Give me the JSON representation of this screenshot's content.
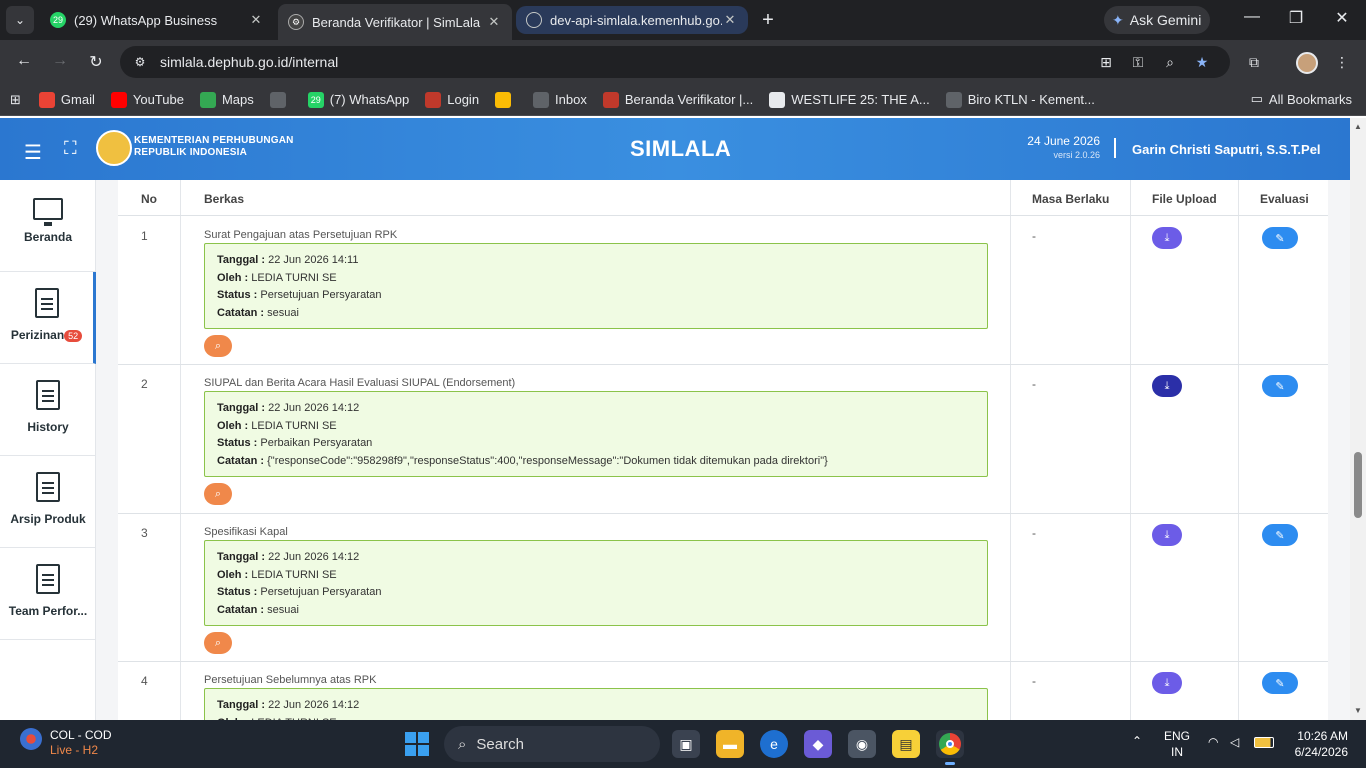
{
  "browser": {
    "tabs": [
      {
        "title": "(29) WhatsApp Business",
        "favicon": "whatsapp-icon",
        "favicon_text": "29"
      },
      {
        "title": "Beranda Verifikator | SimLala",
        "favicon": "simlala-icon"
      },
      {
        "title": "dev-api-simlala.kemenhub.go.id",
        "favicon": "globe-icon"
      }
    ],
    "gemini_label": "Ask Gemini",
    "url": "simlala.dephub.go.id/internal",
    "bookmarks": [
      {
        "label": "Gmail",
        "icon": "gmail-icon",
        "color": "#ea4335"
      },
      {
        "label": "YouTube",
        "icon": "youtube-icon",
        "color": "#ff0000"
      },
      {
        "label": "Maps",
        "icon": "maps-icon",
        "color": "#34a853"
      },
      {
        "label": "",
        "icon": "globe-icon",
        "color": "#5f6368"
      },
      {
        "label": "(7) WhatsApp",
        "icon": "whatsapp-icon",
        "color": "#25d366",
        "icon_text": "29"
      },
      {
        "label": "Login",
        "icon": "simlala-icon",
        "color": "#c0392b"
      },
      {
        "label": "",
        "icon": "photos-icon",
        "color": "#fbbc05"
      },
      {
        "label": "Inbox",
        "icon": "mail-icon",
        "color": "#5f6368"
      },
      {
        "label": "Beranda Verifikator |...",
        "icon": "simlala-icon",
        "color": "#c0392b"
      },
      {
        "label": "WESTLIFE 25: THE A...",
        "icon": "page-icon",
        "color": "#e8eaed"
      },
      {
        "label": "Biro KTLN - Kement...",
        "icon": "globe-icon",
        "color": "#5f6368"
      }
    ],
    "all_bookmarks": "All Bookmarks"
  },
  "app": {
    "ministry_line1": "KEMENTERIAN PERHUBUNGAN",
    "ministry_line2": "REPUBLIK INDONESIA",
    "title": "SIMLALA",
    "date": "24 June 2026",
    "version": "versi 2.0.26",
    "user": "Garin Christi Saputri, S.S.T.Pel"
  },
  "sidebar": {
    "items": [
      {
        "label": "Beranda",
        "icon": "monitor-icon"
      },
      {
        "label": "Perizinan",
        "icon": "document-icon",
        "badge": "52"
      },
      {
        "label": "History",
        "icon": "document-icon"
      },
      {
        "label": "Arsip Produk",
        "icon": "document-icon"
      },
      {
        "label": "Team Perfor...",
        "icon": "document-icon"
      }
    ]
  },
  "table": {
    "headers": {
      "no": "No",
      "berkas": "Berkas",
      "masa": "Masa Berlaku",
      "file": "File Upload",
      "evaluasi": "Evaluasi"
    },
    "labels": {
      "tanggal": "Tanggal :",
      "oleh": "Oleh :",
      "status": "Status :",
      "catatan": "Catatan :"
    },
    "rows": [
      {
        "no": "1",
        "title": "Surat Pengajuan atas Persetujuan RPK",
        "tanggal": "22 Jun 2026 14:11",
        "oleh": "LEDIA TURNI SE",
        "status": "Persetujuan Persyaratan",
        "catatan": "sesuai",
        "masa": "-"
      },
      {
        "no": "2",
        "title": "SIUPAL dan Berita Acara Hasil Evaluasi SIUPAL (Endorsement)",
        "tanggal": "22 Jun 2026 14:12",
        "oleh": "LEDIA TURNI SE",
        "status": "Perbaikan Persyaratan",
        "catatan": "{\"responseCode\":\"958298f9\",\"responseStatus\":400,\"responseMessage\":\"Dokumen tidak ditemukan pada direktori\"}",
        "masa": "-"
      },
      {
        "no": "3",
        "title": "Spesifikasi Kapal",
        "tanggal": "22 Jun 2026 14:12",
        "oleh": "LEDIA TURNI SE",
        "status": "Persetujuan Persyaratan",
        "catatan": "sesuai",
        "masa": "-"
      },
      {
        "no": "4",
        "title": "Persetujuan Sebelumnya atas RPK",
        "tanggal": "22 Jun 2026 14:12",
        "oleh": "LEDIA TURNI SE",
        "status": "",
        "catatan": "",
        "masa": "-"
      }
    ]
  },
  "taskbar": {
    "weather_title": "COL - COD",
    "weather_sub": "Live - H2",
    "search_placeholder": "Search",
    "lang": "ENG",
    "region": "IN",
    "time": "10:26 AM",
    "date": "6/24/2026"
  }
}
